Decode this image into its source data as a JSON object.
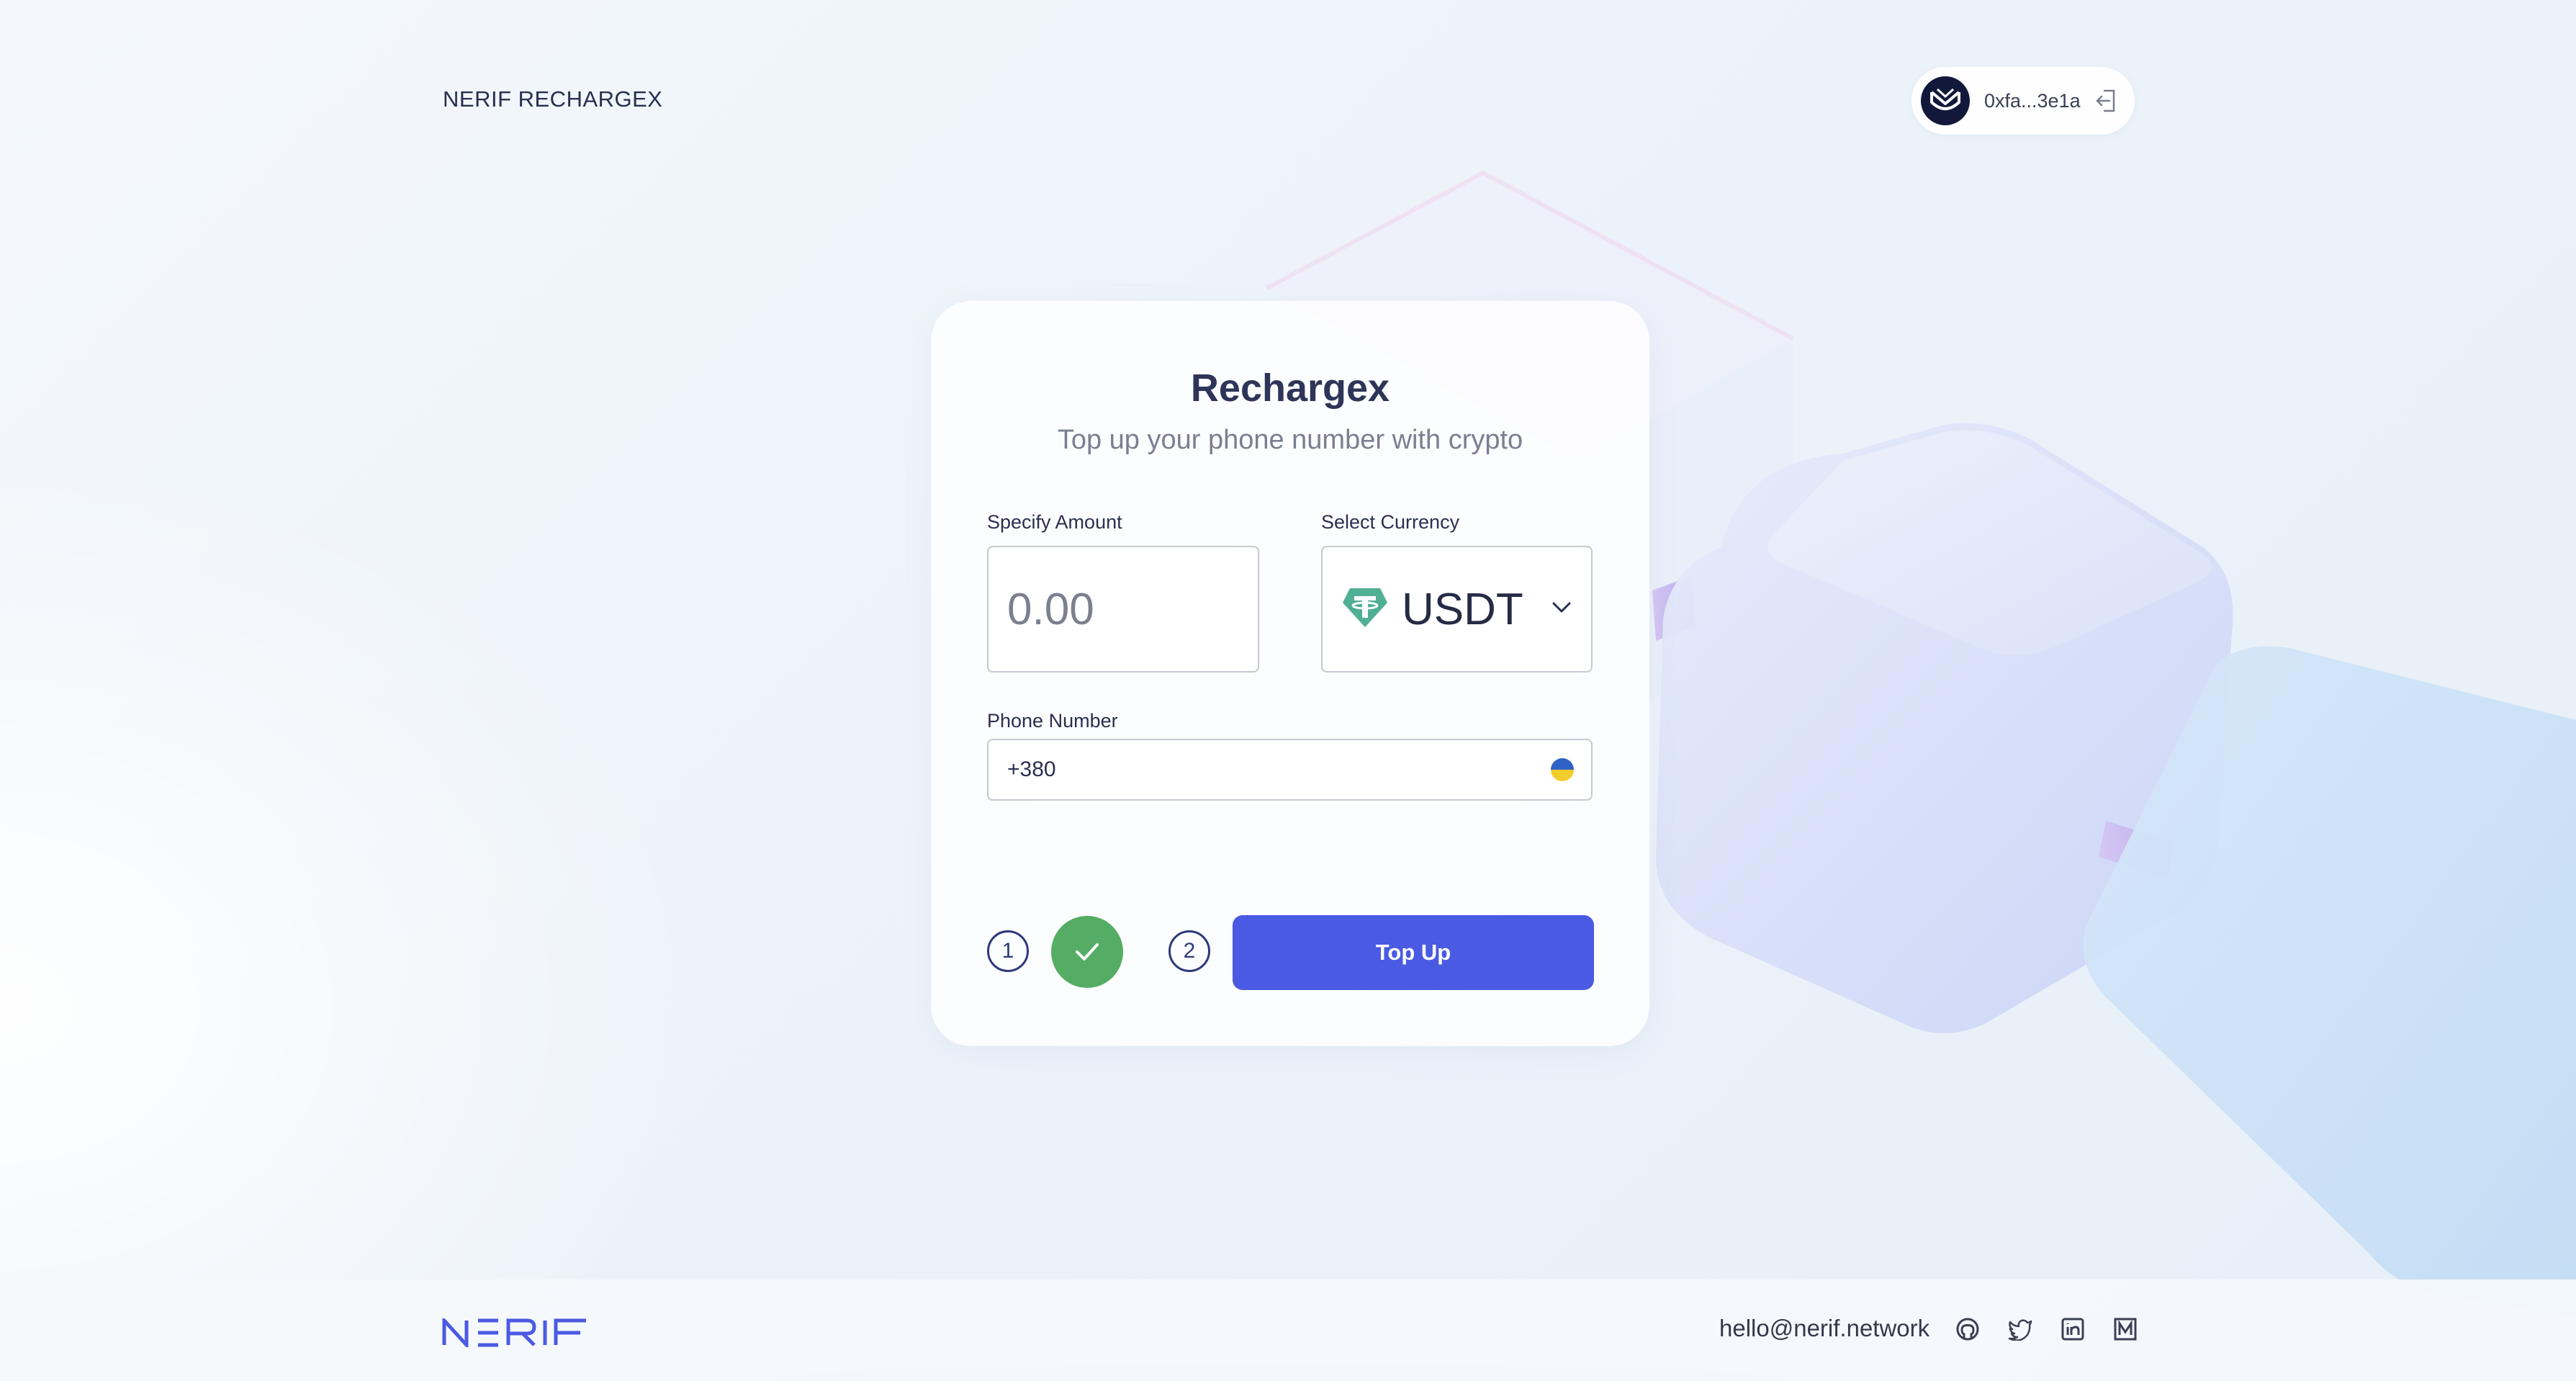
{
  "brand": {
    "title": "NERIF RECHARGEX"
  },
  "wallet": {
    "address": "0xfa...3e1a",
    "logo_icon": "wallet-provider-icon",
    "logout_icon": "logout-icon"
  },
  "card": {
    "title": "Rechargex",
    "subtitle": "Top up your phone number with crypto",
    "amount": {
      "label": "Specify Amount",
      "value": "",
      "placeholder": "0.00"
    },
    "currency": {
      "label": "Select Currency",
      "selected": "USDT",
      "icon": "tether-icon"
    },
    "phone": {
      "label": "Phone Number",
      "value": "+380",
      "flag": "ukraine-flag-icon"
    },
    "steps": [
      {
        "number": "1",
        "status": "completed"
      },
      {
        "number": "2",
        "status": "current"
      }
    ],
    "topup_button": "Top Up"
  },
  "footer": {
    "logo": "NERIF",
    "email": "hello@nerif.network",
    "socials": [
      "github-icon",
      "twitter-icon",
      "linkedin-icon",
      "medium-icon"
    ]
  },
  "colors": {
    "accent": "#4a5ae3",
    "success": "#55ad65",
    "text_dark": "#2f3558",
    "text_muted": "#7a7f92",
    "tether": "#50af95"
  }
}
